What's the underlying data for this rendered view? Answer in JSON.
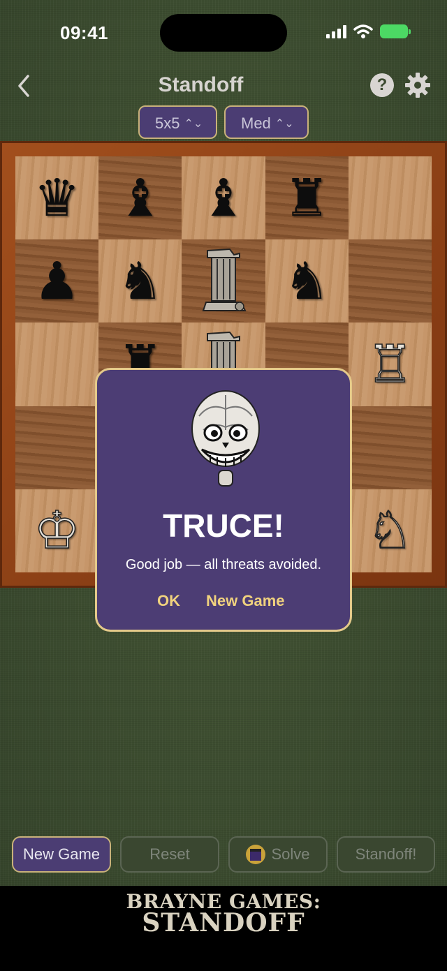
{
  "status": {
    "time": "09:41"
  },
  "header": {
    "title": "Standoff"
  },
  "selectors": {
    "size": "5x5",
    "difficulty": "Med"
  },
  "board": {
    "rows": [
      [
        {
          "glyph": "♛",
          "color": "black"
        },
        {
          "glyph": "♝",
          "color": "black"
        },
        {
          "glyph": "♝",
          "color": "black"
        },
        {
          "glyph": "♜",
          "color": "black"
        },
        {
          "glyph": "",
          "color": ""
        }
      ],
      [
        {
          "glyph": "♟",
          "color": "black"
        },
        {
          "glyph": "♞",
          "color": "black"
        },
        {
          "glyph": "ruin",
          "color": "ruin"
        },
        {
          "glyph": "♞",
          "color": "black"
        },
        {
          "glyph": "",
          "color": ""
        }
      ],
      [
        {
          "glyph": "",
          "color": ""
        },
        {
          "glyph": "♜",
          "color": "black"
        },
        {
          "glyph": "ruin",
          "color": "ruin"
        },
        {
          "glyph": "",
          "color": ""
        },
        {
          "glyph": "♖",
          "color": "white"
        }
      ],
      [
        {
          "glyph": "",
          "color": ""
        },
        {
          "glyph": "",
          "color": ""
        },
        {
          "glyph": "",
          "color": ""
        },
        {
          "glyph": "",
          "color": ""
        },
        {
          "glyph": "",
          "color": ""
        }
      ],
      [
        {
          "glyph": "♔",
          "color": "white"
        },
        {
          "glyph": "",
          "color": ""
        },
        {
          "glyph": "",
          "color": ""
        },
        {
          "glyph": "",
          "color": ""
        },
        {
          "glyph": "♘",
          "color": "white"
        }
      ]
    ]
  },
  "modal": {
    "title": "TRUCE!",
    "message": "Good job — all threats avoided.",
    "ok_label": "OK",
    "new_game_label": "New Game"
  },
  "toolbar": {
    "new_game_label": "New Game",
    "reset_label": "Reset",
    "solve_label": "Solve",
    "standoff_label": "Standoff!"
  },
  "footer": {
    "logo_line1": "BRAYNE GAMES:",
    "logo_line2": "STANDOFF"
  },
  "colors": {
    "purple": "#4b3d73",
    "gold": "#e4c98a",
    "felt": "#3b4a2f"
  }
}
